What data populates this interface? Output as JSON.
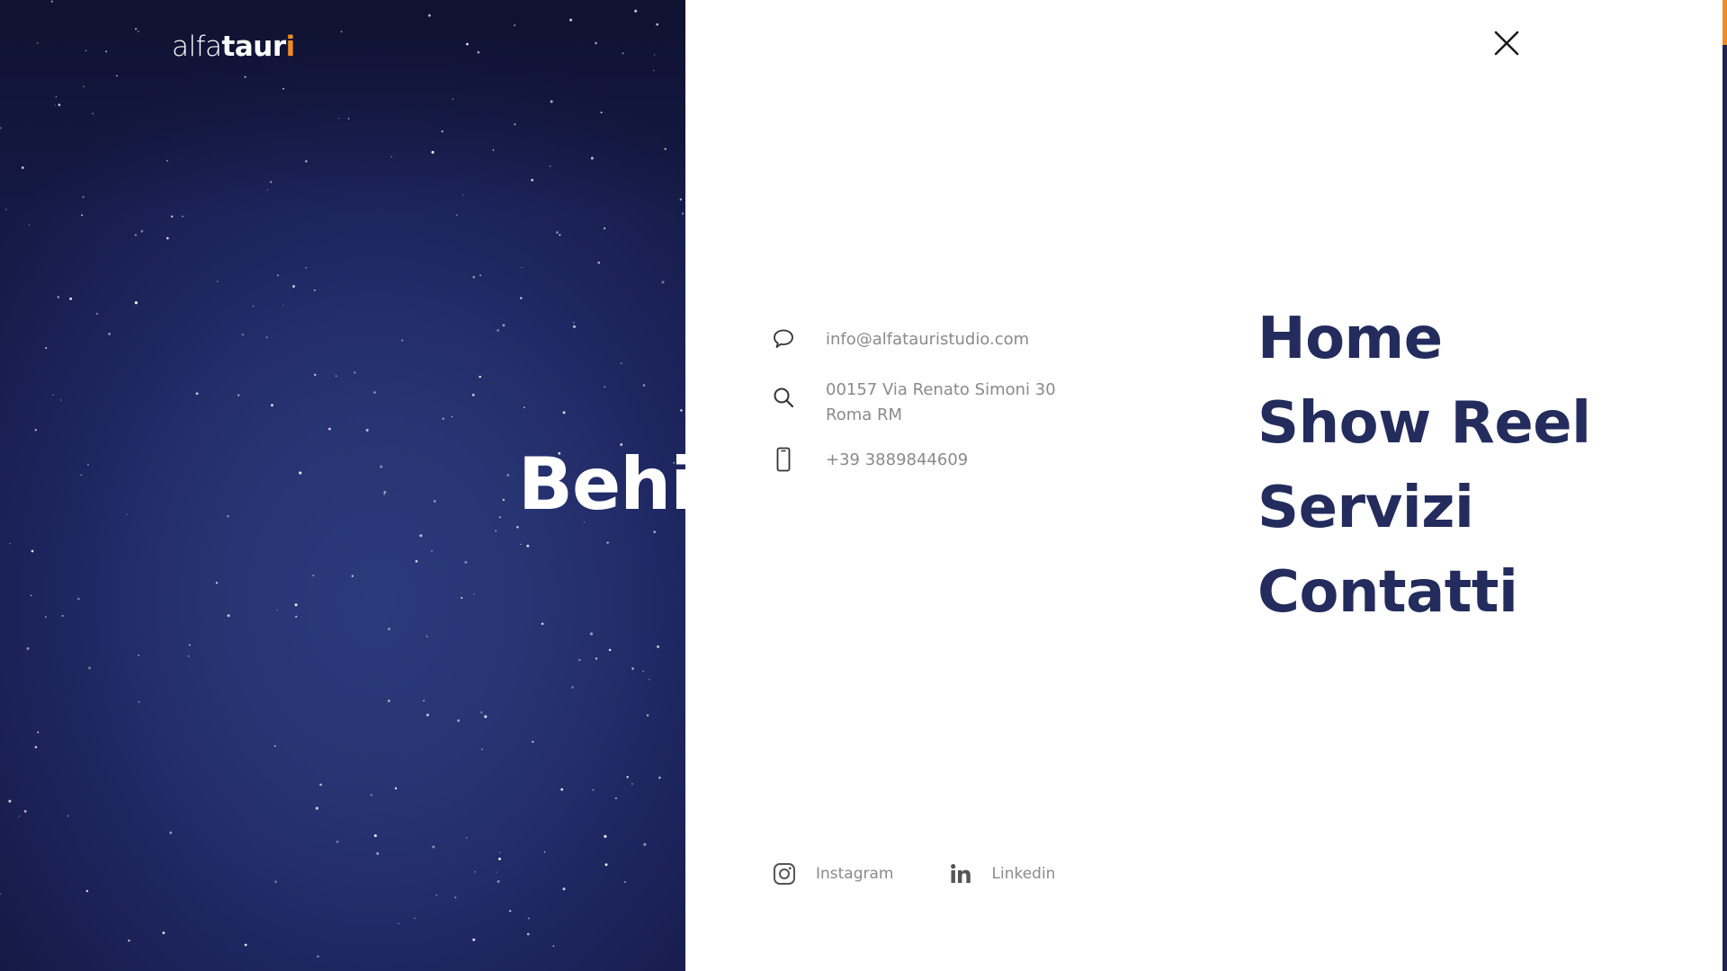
{
  "logo": {
    "part_light": "alfa",
    "part_bold": "taur",
    "part_accent_i": "i"
  },
  "hero": {
    "title": "Behin"
  },
  "close_button": {
    "icon": "close-icon"
  },
  "contact": {
    "email": "info@alfatauristudio.com",
    "email_icon": "chat-bubble-icon",
    "address_line1": "00157 Via Renato Simoni 30",
    "address_line2": "Roma RM",
    "address_icon": "search-icon",
    "phone": "+39 3889844609",
    "phone_icon": "smartphone-icon"
  },
  "nav": {
    "items": [
      {
        "label": "Home"
      },
      {
        "label": "Show Reel"
      },
      {
        "label": "Servizi"
      },
      {
        "label": "Contatti"
      }
    ]
  },
  "social": {
    "instagram": {
      "label": "Instagram",
      "icon": "instagram-icon"
    },
    "linkedin": {
      "label": "Linkedin",
      "icon": "linkedin-icon"
    }
  },
  "colors": {
    "nav_text": "#232c5c",
    "muted_text": "#8a8a8a",
    "accent": "#f08a24",
    "hero_bg": "#273472"
  }
}
